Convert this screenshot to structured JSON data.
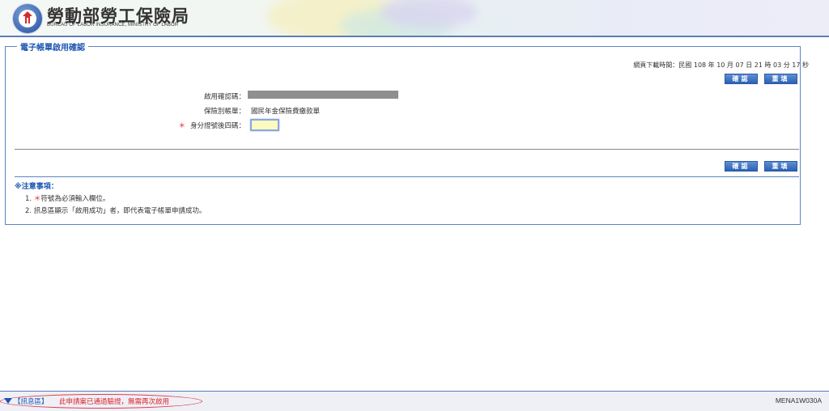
{
  "header": {
    "org_name_zh": "勞動部勞工保險局",
    "org_name_en": "BUREAU OF LABOR INSURANCE, MINISTRY OF LABOR"
  },
  "form": {
    "title": "電子帳單啟用確認",
    "timestamp": "網頁下載時間：民國 108 年 10 月 07 日 21 時 03 分 17 秒",
    "confirm_label": "確認",
    "reset_label": "重填",
    "activation_code_label": "啟用確認碼：",
    "bill_type_label": "保險別帳單：",
    "bill_type_value": "國民年金保險費繳款單",
    "id_last4_label": "身分證號後四碼：",
    "required_mark": "＊",
    "id_last4_value": ""
  },
  "notes": {
    "title": "※注意事項：",
    "items": [
      {
        "prefix": "1. ",
        "star": "＊",
        "text": "符號為必須輸入欄位。"
      },
      {
        "prefix": "2. ",
        "star": "",
        "text": "訊息區顯示「啟用成功」者，即代表電子帳單申請成功。"
      }
    ]
  },
  "footer": {
    "message_area_label": "【訊息區】",
    "message": "此申請案已通過驗證，無需再次啟用",
    "page_code": "MENA1W030A"
  },
  "colors": {
    "accent_blue": "#1b55b3",
    "required_red": "#e0222a",
    "button_blue": "#2b61b4"
  }
}
